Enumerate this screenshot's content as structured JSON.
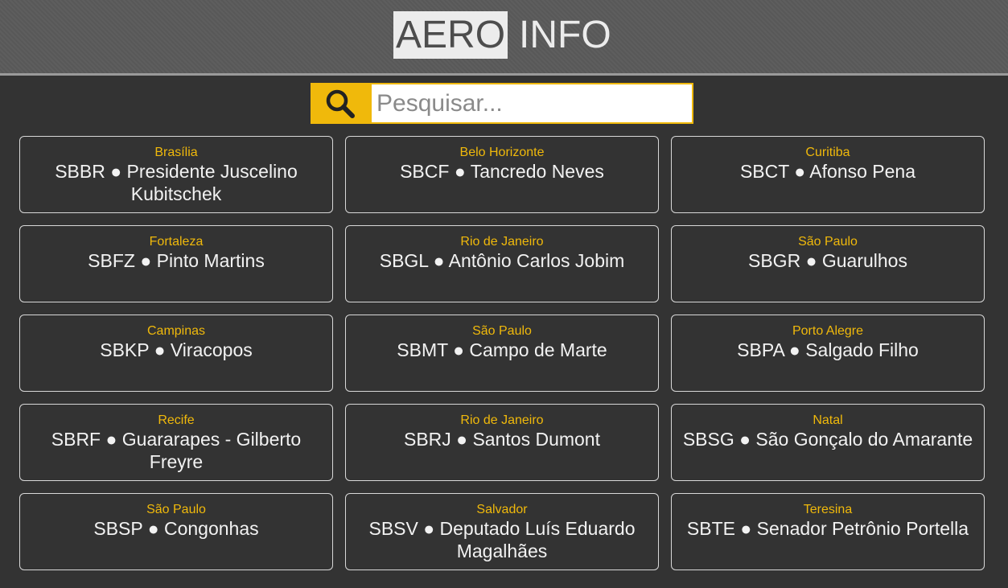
{
  "header": {
    "logo_part1": "AERO",
    "logo_part2": "INFO"
  },
  "search": {
    "placeholder": "Pesquisar...",
    "icon": "magnifier-icon"
  },
  "colors": {
    "accent": "#f0b90b",
    "background": "#333333",
    "header": "#5a5a5a"
  },
  "airports": [
    {
      "city": "Brasília",
      "name": "SBBR ● Presidente Juscelino Kubitschek"
    },
    {
      "city": "Belo Horizonte",
      "name": "SBCF ● Tancredo Neves"
    },
    {
      "city": "Curitiba",
      "name": "SBCT ● Afonso Pena"
    },
    {
      "city": "Fortaleza",
      "name": "SBFZ ● Pinto Martins"
    },
    {
      "city": "Rio de Janeiro",
      "name": "SBGL ● Antônio Carlos Jobim"
    },
    {
      "city": "São Paulo",
      "name": "SBGR ● Guarulhos"
    },
    {
      "city": "Campinas",
      "name": "SBKP ● Viracopos"
    },
    {
      "city": "São Paulo",
      "name": "SBMT ● Campo de Marte"
    },
    {
      "city": "Porto Alegre",
      "name": "SBPA ● Salgado Filho"
    },
    {
      "city": "Recife",
      "name": "SBRF ● Guararapes - Gilberto Freyre"
    },
    {
      "city": "Rio de Janeiro",
      "name": "SBRJ ● Santos Dumont"
    },
    {
      "city": "Natal",
      "name": "SBSG ● São Gonçalo do Amarante"
    },
    {
      "city": "São Paulo",
      "name": "SBSP ● Congonhas"
    },
    {
      "city": "Salvador",
      "name": "SBSV ● Deputado Luís Eduardo Magalhães"
    },
    {
      "city": "Teresina",
      "name": "SBTE ● Senador Petrônio Portella"
    }
  ]
}
